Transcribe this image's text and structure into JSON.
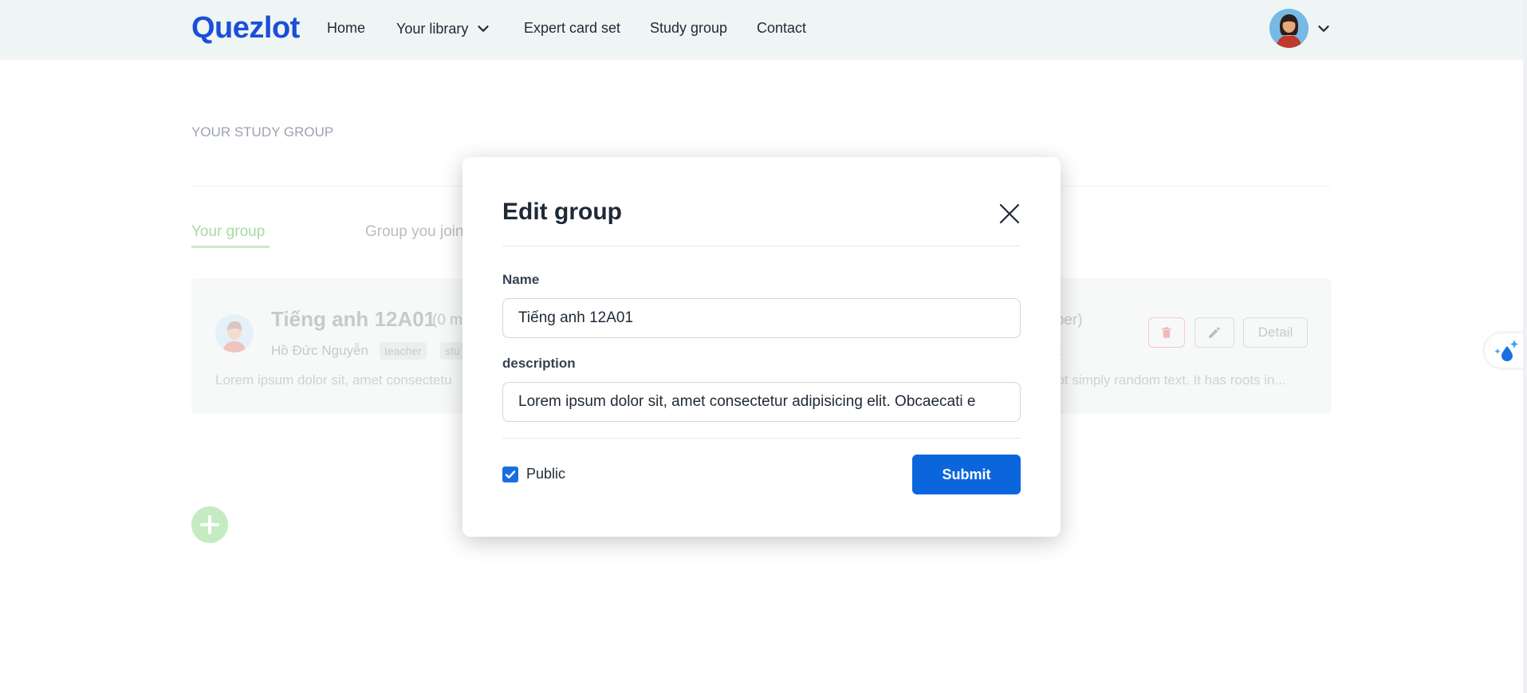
{
  "navbar": {
    "logo": "Quezlot",
    "items": [
      {
        "label": "Home"
      },
      {
        "label": "Your library"
      },
      {
        "label": "Expert card set"
      },
      {
        "label": "Study group"
      },
      {
        "label": "Contact"
      }
    ]
  },
  "page": {
    "section_title": "YOUR STUDY GROUP",
    "tabs": [
      {
        "label": "Your group",
        "active": true
      },
      {
        "label": "Group you join",
        "active": false
      }
    ],
    "group_card": {
      "title": "Tiếng anh 12A01",
      "member_count_left": "(0 m",
      "member_count_right": "mber)",
      "owner": "Hồ Đức Nguyễn",
      "tags": [
        "teacher",
        "stu"
      ],
      "tag_right": "nt",
      "description_left": "Lorem ipsum dolor sit, amet consectetu",
      "description_right": "not simply random text. It has roots in...",
      "detail_label": "Detail"
    }
  },
  "modal": {
    "title": "Edit group",
    "name_label": "Name",
    "name_value": "Tiếng anh 12A01",
    "description_label": "description",
    "description_value": "Lorem ipsum dolor sit, amet consectetur adipisicing elit. Obcaecati e",
    "public_label": "Public",
    "public_checked": true,
    "submit_label": "Submit"
  },
  "colors": {
    "brand": "#1a4fd8",
    "primary_button": "#0b66dd",
    "active_tab": "#a8dba0"
  }
}
